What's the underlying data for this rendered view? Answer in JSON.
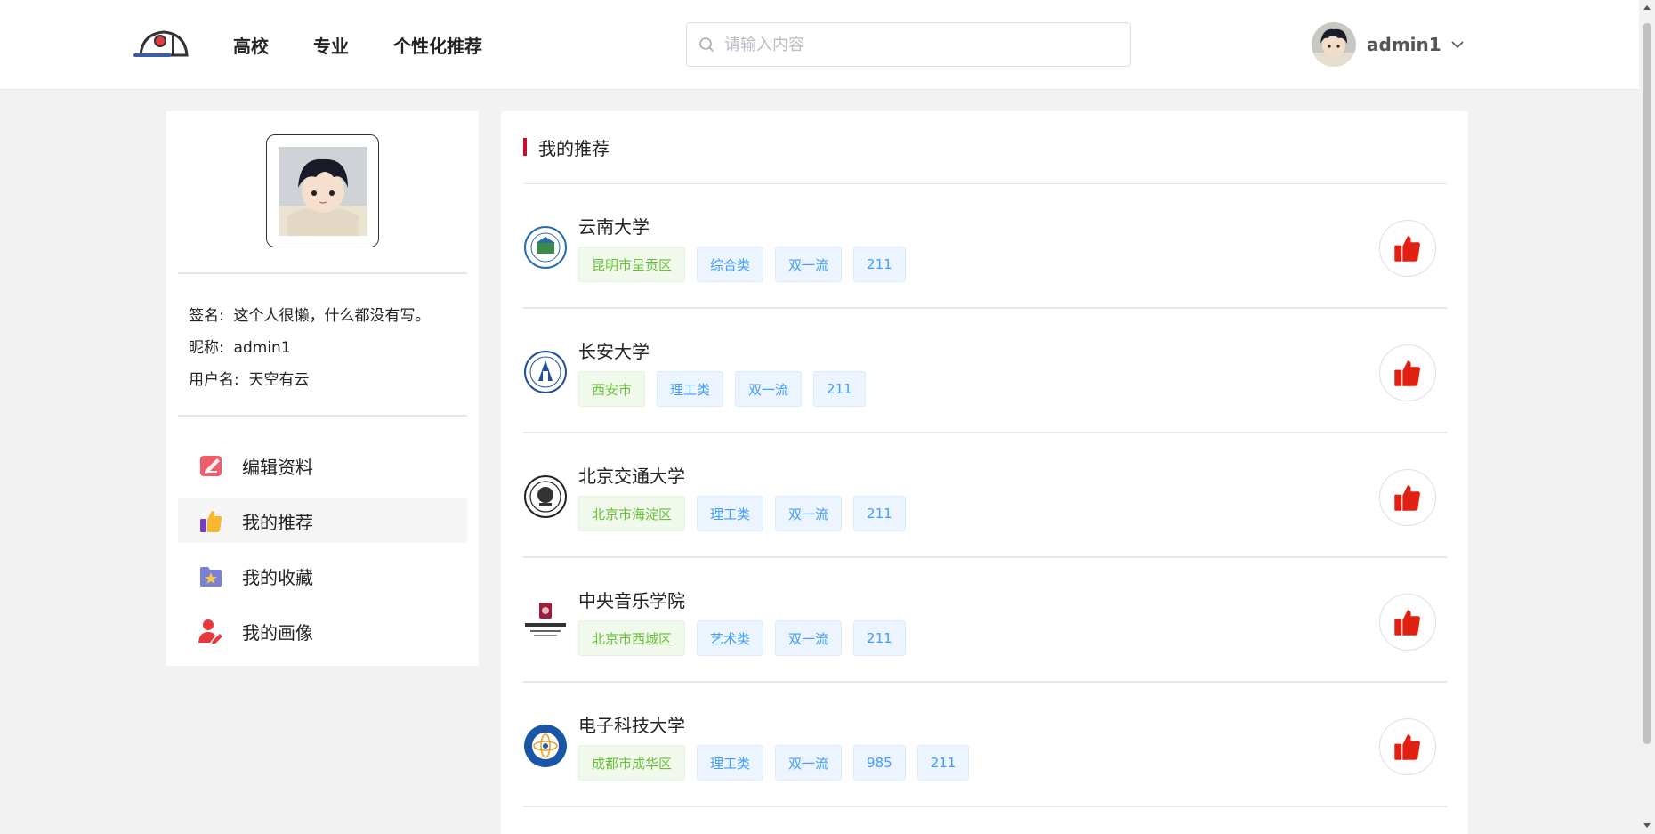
{
  "header": {
    "nav": [
      {
        "label": "高校"
      },
      {
        "label": "专业"
      },
      {
        "label": "个性化推荐"
      }
    ],
    "search": {
      "placeholder": "请输入内容",
      "value": ""
    },
    "user": {
      "name": "admin1"
    }
  },
  "profile": {
    "signature_label": "签名:",
    "signature": "这个人很懒，什么都没有写。",
    "nickname_label": "昵称:",
    "nickname": "admin1",
    "username_label": "用户名:",
    "username": "天空有云"
  },
  "menu": [
    {
      "label": "编辑资料",
      "icon": "edit-icon"
    },
    {
      "label": "我的推荐",
      "icon": "thumbs-up-icon"
    },
    {
      "label": "我的收藏",
      "icon": "favorite-folder-icon"
    },
    {
      "label": "我的画像",
      "icon": "user-profile-icon"
    }
  ],
  "recommend": {
    "title": "我的推荐",
    "items": [
      {
        "name": "云南大学",
        "location": "昆明市呈贡区",
        "tags": [
          "综合类",
          "双一流",
          "211"
        ]
      },
      {
        "name": "长安大学",
        "location": "西安市",
        "tags": [
          "理工类",
          "双一流",
          "211"
        ]
      },
      {
        "name": "北京交通大学",
        "location": "北京市海淀区",
        "tags": [
          "理工类",
          "双一流",
          "211"
        ]
      },
      {
        "name": "中央音乐学院",
        "location": "北京市西城区",
        "tags": [
          "艺术类",
          "双一流",
          "211"
        ]
      },
      {
        "name": "电子科技大学",
        "location": "成都市成华区",
        "tags": [
          "理工类",
          "双一流",
          "985",
          "211"
        ]
      }
    ]
  },
  "colors": {
    "accent": "#c8102e",
    "like": "#e02010",
    "tag_green": "#67c23a",
    "tag_blue": "#409eff"
  }
}
